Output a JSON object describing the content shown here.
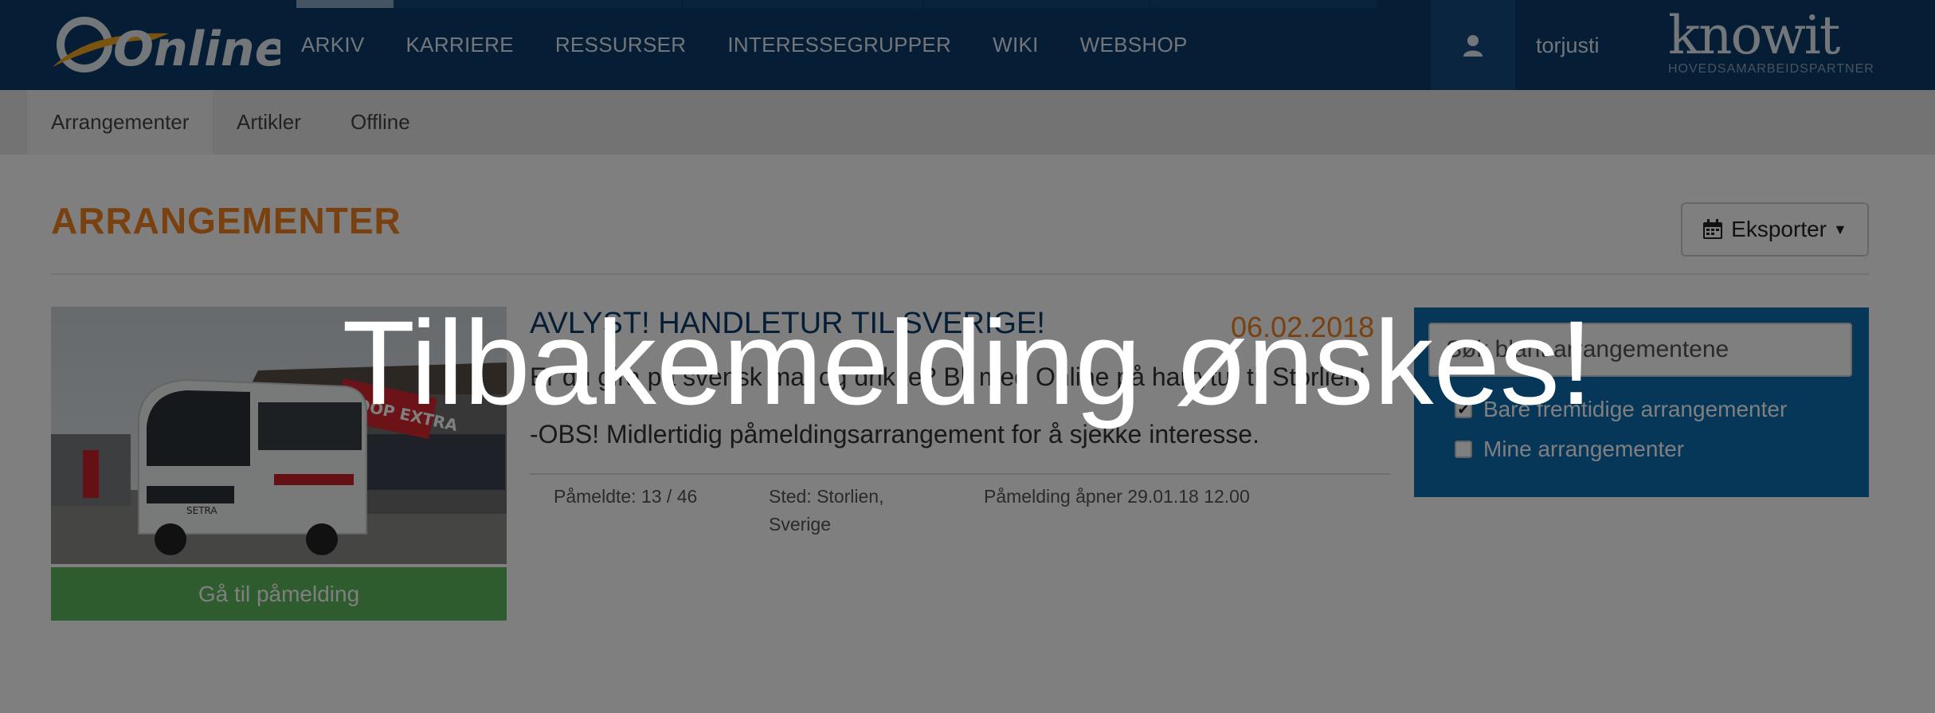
{
  "topnav": {
    "logo_text": "Online",
    "links": [
      "ARKIV",
      "KARRIERE",
      "RESSURSER",
      "INTERESSEGRUPPER",
      "WIKI",
      "WEBSHOP"
    ],
    "username": "torjusti",
    "partner_brand": "knowit",
    "partner_subtitle": "HOVEDSAMARBEIDSPARTNER",
    "user_icon": "user-icon"
  },
  "subnav": {
    "tabs": [
      "Arrangementer",
      "Artikler",
      "Offline"
    ],
    "active": "Arrangementer"
  },
  "main": {
    "title": "ARRANGEMENTER",
    "export_label": "Eksporter",
    "export_icon": "calendar-icon"
  },
  "event": {
    "title": "AVLYST! HANDLETUR TIL SVERIGE!",
    "date": "06.02.2018",
    "description": "Er du gira på svensk mat og drikke? Bli med Online på harrytur til Storlien!",
    "note": "-OBS! Midlertidig påmeldingsarrangement for å sjekke interesse.",
    "attendees": "Påmeldte: 13 / 46",
    "location_line1": "Sted: Storlien,",
    "location_line2": "Sverige",
    "registration_opens": "Påmelding åpner 29.01.18 12.00",
    "signup_label": "Gå til påmelding",
    "image_sign_text": "COOP EXTRA"
  },
  "filter": {
    "search_placeholder": "Søk blant arrangementene",
    "options": [
      {
        "label": "Bare fremtidige arrangementer",
        "checked": true
      },
      {
        "label": "Mine arrangementer",
        "checked": false
      }
    ]
  },
  "overlay": {
    "text": "Tilbakemelding ønskes!"
  },
  "colors": {
    "nav": "#0d3d6b",
    "accent": "#f58220",
    "success": "#5cb85c",
    "filter_panel": "#0c6fb3",
    "overlay": "rgba(0,0,0,0.5)"
  }
}
